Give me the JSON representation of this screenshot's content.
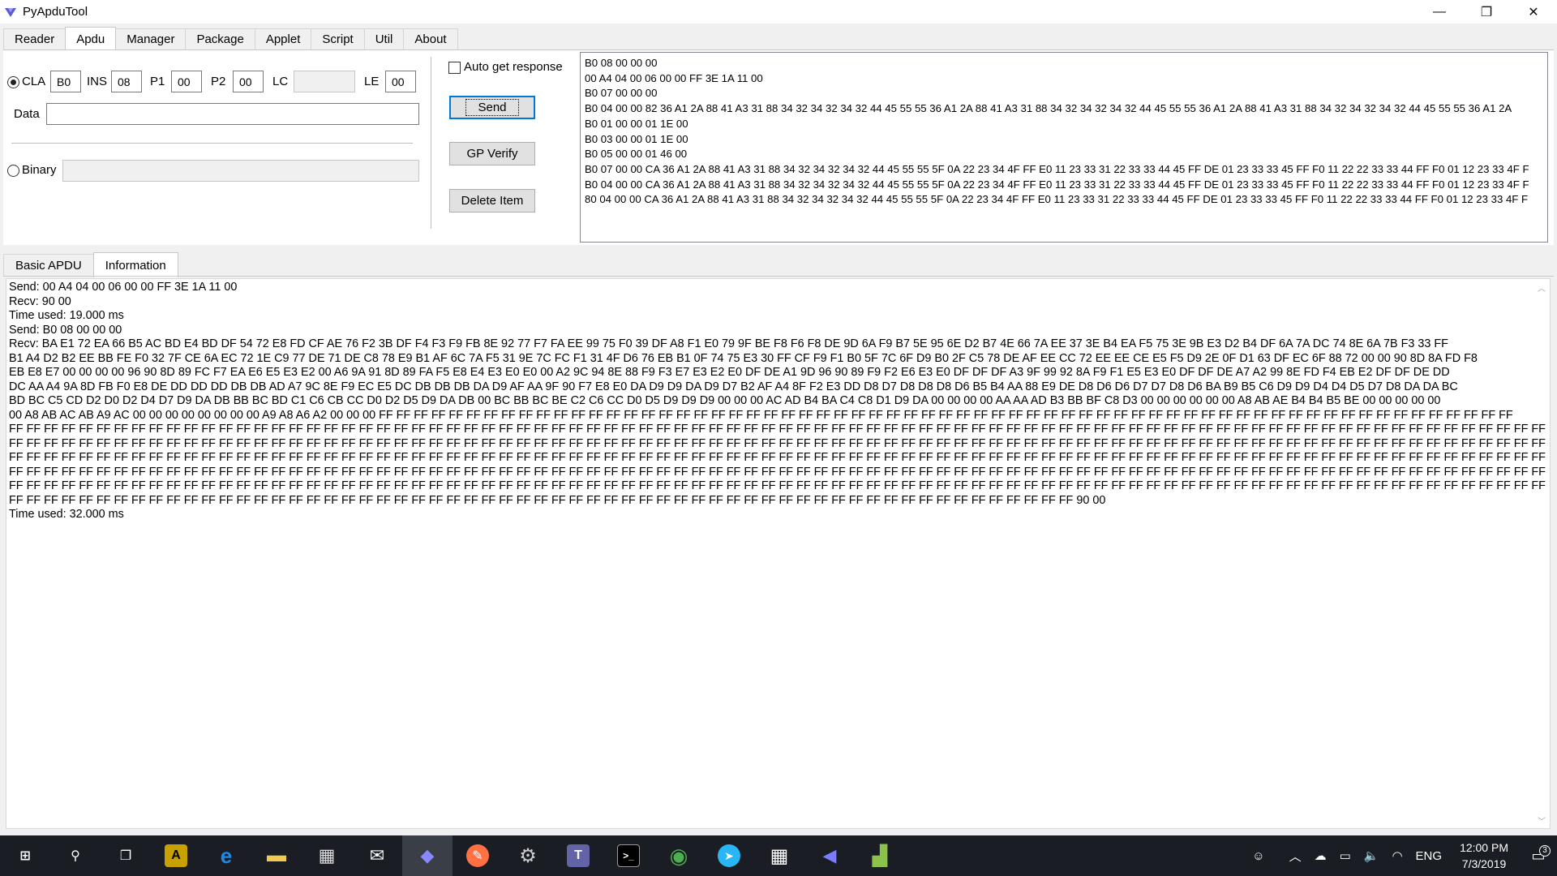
{
  "window": {
    "title": "PyApduTool",
    "minimize_glyph": "—",
    "restore_glyph": "❐",
    "close_glyph": "✕"
  },
  "top_tabs": [
    "Reader",
    "Apdu",
    "Manager",
    "Package",
    "Applet",
    "Script",
    "Util",
    "About"
  ],
  "apdu": {
    "cla_label": "CLA",
    "cla_value": "B0",
    "ins_label": "INS",
    "ins_value": "08",
    "p1_label": "P1",
    "p1_value": "00",
    "p2_label": "P2",
    "p2_value": "00",
    "lc_label": "LC",
    "lc_value": "",
    "le_label": "LE",
    "le_value": "00",
    "data_label": "Data",
    "data_value": "",
    "binary_label": "Binary",
    "binary_value": "",
    "auto_get_response_label": "Auto get response",
    "send_label": "Send",
    "gp_verify_label": "GP Verify",
    "delete_item_label": "Delete Item"
  },
  "command_list": [
    "B0 08 00 00 00",
    "00 A4 04 00 06 00 00 FF 3E 1A 11 00",
    "B0 07 00 00 00",
    "B0 04 00 00 82 36 A1 2A 88 41 A3 31 88 34 32 34 32 34 32 44 45 55 55 36 A1 2A 88 41 A3 31 88 34 32 34 32 34 32 44 45 55 55 36 A1 2A 88 41 A3 31 88 34 32 34 32 34 32 44 45 55 55 36 A1 2A",
    "B0 01 00 00 01 1E 00",
    "B0 03 00 00 01 1E 00",
    "B0 05 00 00 01 46 00",
    "B0 07 00 00 CA 36 A1 2A 88 41 A3 31 88 34 32 34 32 34 32 44 45 55 55 5F 0A 22 23 34 4F FF E0 11 23 33 31 22 33 33 44 45 FF DE 01 23 33 33 45 FF F0 11 22 22 33 33 44 FF F0 01 12 23 33 4F F",
    "B0 04 00 00 CA 36 A1 2A 88 41 A3 31 88 34 32 34 32 34 32 44 45 55 55 5F 0A 22 23 34 4F FF E0 11 23 33 31 22 33 33 44 45 FF DE 01 23 33 33 45 FF F0 11 22 22 33 33 44 FF F0 01 12 23 33 4F F",
    "80 04 00 00 CA 36 A1 2A 88 41 A3 31 88 34 32 34 32 34 32 44 45 55 55 5F 0A 22 23 34 4F FF E0 11 23 33 31 22 33 33 44 45 FF DE 01 23 33 33 45 FF F0 11 22 22 33 33 44 FF F0 01 12 23 33 4F F"
  ],
  "lower_tabs": [
    "Basic APDU",
    "Information"
  ],
  "output_lines": [
    "Send: 00 A4 04 00 06 00 00 FF 3E 1A 11 00",
    "Recv: 90 00",
    "Time used: 19.000 ms",
    "Send: B0 08 00 00 00",
    "Recv: BA E1 72 EA 66 B5 AC BD E4 BD DF 54 72 E8 FD CF AE 76 F2 3B DF F4 F3 F9 FB 8E 92 77 F7 FA EE 99 75 F0 39 DF A8 F1 E0 79 9F BE F8 F6 F8 DE 9D 6A F9 B7 5E 95 6E D2 B7 4E 66 7A EE 37 3E B4 EA F5 75 3E 9B E3 D2 B4 DF 6A 7A DC 74 8E 6A 7B F3 33 FF",
    "B1 A4 D2 B2 EE BB FE F0 32 7F CE 6A EC 72 1E C9 77 DE 71 DE C8 78 E9 B1 AF 6C 7A F5 31 9E 7C FC F1 31 4F D6 76 EB B1 0F 74 75 E3 30 FF CF F9 F1 B0 5F 7C 6F D9 B0 2F C5 78 DE AF EE CC 72 EE EE CE E5 F5 D9 2E 0F D1 63 DF EC 6F 88 72 00 00 90 8D 8A FD F8",
    "EB E8 E7 00 00 00 00 96 90 8D 89 FC F7 EA E6 E5 E3 E2 00 A6 9A 91 8D 89 FA F5 E8 E4 E3 E0 E0 00 A2 9C 94 8E 88 F9 F3 E7 E3 E2 E0 DF DE A1 9D 96 90 89 F9 F2 E6 E3 E0 DF DF DF A3 9F 99 92 8A F9 F1 E5 E3 E0 DF DF DE A7 A2 99 8E FD F4 EB E2 DF DF DE DD",
    "DC AA A4 9A 8D FB F0 E8 DE DD DD DD DB DB AD A7 9C 8E F9 EC E5 DC DB DB DB DA D9 AF AA 9F 90 F7 E8 E0 DA D9 D9 DA D9 D7 B2 AF A4 8F F2 E3 DD D8 D7 D8 D8 D8 D6 B5 B4 AA 88 E9 DE D8 D6 D6 D7 D7 D8 D6 BA B9 B5 C6 D9 D9 D4 D4 D5 D7 D8 DA DA BC",
    "BD BC C5 CD D2 D0 D2 D4 D7 D9 DA DB BB BC BD C1 C6 CB CC D0 D2 D5 D9 DA DB 00 BC BB BC BE C2 C6 CC D0 D5 D9 D9 D9 00 00 00 AC AD B4 BA C4 C8 D1 D9 DA 00 00 00 00 AA AA AD B3 BB BF C8 D3 00 00 00 00 00 00 A8 AB AE B4 B4 B5 BE 00 00 00 00 00",
    "00 A8 AB AC AB A9 AC 00 00 00 00 00 00 00 00 A9 A8 A6 A2 00 00 00 FF FF FF FF FF FF FF FF FF FF FF FF FF FF FF FF FF FF FF FF FF FF FF FF FF FF FF FF FF FF FF FF FF FF FF FF FF FF FF FF FF FF FF FF FF FF FF FF FF FF FF FF FF FF FF FF FF FF FF FF FF FF FF FF FF",
    "FF FF FF FF FF FF FF FF FF FF FF FF FF FF FF FF FF FF FF FF FF FF FF FF FF FF FF FF FF FF FF FF FF FF FF FF FF FF FF FF FF FF FF FF FF FF FF FF FF FF FF FF FF FF FF FF FF FF FF FF FF FF FF FF FF FF FF FF FF FF FF FF FF FF FF FF FF FF FF FF FF FF FF FF FF FF FF FF FF FF",
    "FF FF FF FF FF FF FF FF FF FF FF FF FF FF FF FF FF FF FF FF FF FF FF FF FF FF FF FF FF FF FF FF FF FF FF FF FF FF FF FF FF FF FF FF FF FF FF FF FF FF FF FF FF FF FF FF FF FF FF FF FF FF FF FF FF FF FF FF FF FF FF FF FF FF FF FF FF FF FF FF FF FF FF FF FF FF FF FF FF FF",
    "FF FF FF FF FF FF FF FF FF FF FF FF FF FF FF FF FF FF FF FF FF FF FF FF FF FF FF FF FF FF FF FF FF FF FF FF FF FF FF FF FF FF FF FF FF FF FF FF FF FF FF FF FF FF FF FF FF FF FF FF FF FF FF FF FF FF FF FF FF FF FF FF FF FF FF FF FF FF FF FF FF FF FF FF FF FF FF FF FF FF",
    "FF FF FF FF FF FF FF FF FF FF FF FF FF FF FF FF FF FF FF FF FF FF FF FF FF FF FF FF FF FF FF FF FF FF FF FF FF FF FF FF FF FF FF FF FF FF FF FF FF FF FF FF FF FF FF FF FF FF FF FF FF FF FF FF FF FF FF FF FF FF FF FF FF FF FF FF FF FF FF FF FF FF FF FF FF FF FF FF FF FF",
    "FF FF FF FF FF FF FF FF FF FF FF FF FF FF FF FF FF FF FF FF FF FF FF FF FF FF FF FF FF FF FF FF FF FF FF FF FF FF FF FF FF FF FF FF FF FF FF FF FF FF FF FF FF FF FF FF FF FF FF FF FF FF FF FF FF FF FF FF FF FF FF FF FF FF FF FF FF FF FF FF FF FF FF FF FF FF FF FF FF FF",
    "FF FF FF FF FF FF FF FF FF FF FF FF FF FF FF FF FF FF FF FF FF FF FF FF FF FF FF FF FF FF FF FF FF FF FF FF FF FF FF FF FF FF FF FF FF FF FF FF FF FF FF FF FF FF FF FF FF FF FF FF FF 90 00",
    "Time used: 32.000 ms"
  ],
  "taskbar": {
    "items": [
      {
        "name": "start-button",
        "icon": "windows-logo-icon",
        "glyph": "⊞",
        "color": "#ffffff"
      },
      {
        "name": "search-button",
        "icon": "search-icon",
        "glyph": "⚲",
        "color": "#ffffff"
      },
      {
        "name": "task-view-button",
        "icon": "task-view-icon",
        "glyph": "❐",
        "color": "#ffffff"
      },
      {
        "name": "taskbar-app-1",
        "icon": "app-icon",
        "glyph": "A",
        "color": "#c8a000"
      },
      {
        "name": "taskbar-edge",
        "icon": "edge-icon",
        "glyph": "e",
        "color": "#1e88e5"
      },
      {
        "name": "taskbar-file-explorer",
        "icon": "folder-icon",
        "glyph": "▬",
        "color": "#f2c94c"
      },
      {
        "name": "taskbar-store",
        "icon": "store-icon",
        "glyph": "▦",
        "color": "#dddddd"
      },
      {
        "name": "taskbar-mail",
        "icon": "mail-icon",
        "glyph": "✉",
        "color": "#ffffff"
      },
      {
        "name": "taskbar-pyapdutool",
        "icon": "pyapdutool-icon",
        "glyph": "◆",
        "color": "#6f6cff"
      },
      {
        "name": "taskbar-app-feather",
        "icon": "feather-icon",
        "glyph": "✎",
        "color": "#ff7043"
      },
      {
        "name": "taskbar-settings-app",
        "icon": "gear-icon",
        "glyph": "⚙",
        "color": "#cccccc"
      },
      {
        "name": "taskbar-teams",
        "icon": "teams-icon",
        "glyph": "T",
        "color": "#6264a7"
      },
      {
        "name": "taskbar-terminal",
        "icon": "terminal-icon",
        "glyph": ">_",
        "color": "#ffffff"
      },
      {
        "name": "taskbar-chrome",
        "icon": "chrome-icon",
        "glyph": "◉",
        "color": "#4caf50"
      },
      {
        "name": "taskbar-telegram",
        "icon": "telegram-icon",
        "glyph": "➤",
        "color": "#29b6f6"
      },
      {
        "name": "taskbar-calculator",
        "icon": "calculator-icon",
        "glyph": "▦",
        "color": "#ffffff"
      },
      {
        "name": "taskbar-app-arrow",
        "icon": "arrow-app-icon",
        "glyph": "◀",
        "color": "#7c7cff"
      },
      {
        "name": "taskbar-app-chart",
        "icon": "chart-app-icon",
        "glyph": "▟",
        "color": "#8bc34a"
      }
    ],
    "tray": {
      "people_glyph": "☺",
      "chevron_glyph": "︿",
      "network_glyph": "☁",
      "battery_glyph": "▭",
      "volume_glyph": "🔈",
      "wifi_glyph": "◠",
      "language": "ENG",
      "time": "12:00 PM",
      "date": "7/3/2019",
      "notification_glyph": "▭",
      "notification_count": "3"
    }
  }
}
